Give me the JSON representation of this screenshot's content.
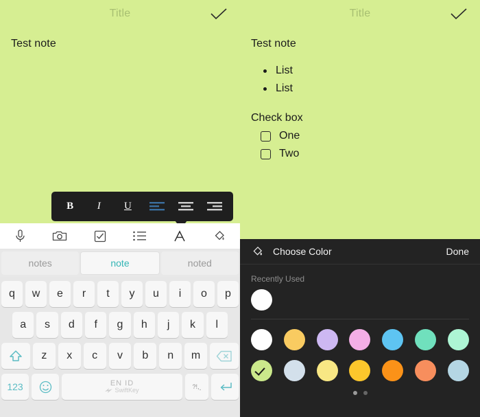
{
  "colors": {
    "note_bg": "#d6ee92",
    "note_title": "#a8bf72",
    "toolbar_bg": "#1f1f1f",
    "align_active": "#3b6fa0",
    "suggestion_active": "#33b5b5",
    "picker_bg": "#232323",
    "keyboard_bg": "#e7e7e7"
  },
  "left_panel": {
    "header": {
      "title": "Title",
      "confirm_icon": "checkmark-icon"
    },
    "note_text": "Test note"
  },
  "right_panel": {
    "header": {
      "title": "Title",
      "confirm_icon": "checkmark-icon"
    },
    "note_text": "Test note",
    "bullets": [
      "List",
      "List"
    ],
    "section_heading": "Check box",
    "checkboxes": [
      {
        "label": "One",
        "checked": false
      },
      {
        "label": "Two",
        "checked": false
      }
    ]
  },
  "format_bar": {
    "bold_label": "B",
    "italic_label": "I",
    "underline_label": "U",
    "align_left": "align-left-icon",
    "align_center": "align-center-icon",
    "align_right": "align-right-icon",
    "active_alignment": "align_left"
  },
  "keyboard": {
    "toolbar_icons": [
      "microphone-icon",
      "camera-icon",
      "checkbox-icon",
      "bullet-list-icon",
      "text-format-icon",
      "paint-bucket-icon"
    ],
    "suggestions": [
      {
        "text": "notes",
        "active": false
      },
      {
        "text": "note",
        "active": true
      },
      {
        "text": "noted",
        "active": false
      }
    ],
    "row1": [
      "q",
      "w",
      "e",
      "r",
      "t",
      "y",
      "u",
      "i",
      "o",
      "p"
    ],
    "row2": [
      "a",
      "s",
      "d",
      "f",
      "g",
      "h",
      "j",
      "k",
      "l"
    ],
    "row3": [
      "z",
      "x",
      "c",
      "v",
      "b",
      "n",
      "m"
    ],
    "shift_icon": "shift-up-arrow-icon",
    "backspace_icon": "backspace-icon",
    "numeric_key": "123",
    "emoji_icon": "smiley-face-icon",
    "space_primary": "EN ID",
    "space_secondary": "SwiftKey",
    "punct_top": "?!,",
    "punct_bottom": ".",
    "enter_icon": "enter-return-icon"
  },
  "color_picker": {
    "bucket_icon": "paint-bucket-icon",
    "title": "Choose Color",
    "done_label": "Done",
    "recently_used_label": "Recently Used",
    "recently_used": [
      "#ffffff"
    ],
    "grid_row1": [
      "#ffffff",
      "#f9cb61",
      "#cdb8f2",
      "#f4aee6",
      "#5ec4f2",
      "#70e0bd",
      "#adf5d4"
    ],
    "grid_row2": [
      "#cbe98b",
      "#d3e0eb",
      "#f8e784",
      "#fcc72c",
      "#fb9218",
      "#f78e5d",
      "#b4d6e4"
    ],
    "selected_swatch": "#cbe98b",
    "selected_index": 0,
    "selected_row": 2,
    "page_dots": 2,
    "active_dot": 0
  }
}
